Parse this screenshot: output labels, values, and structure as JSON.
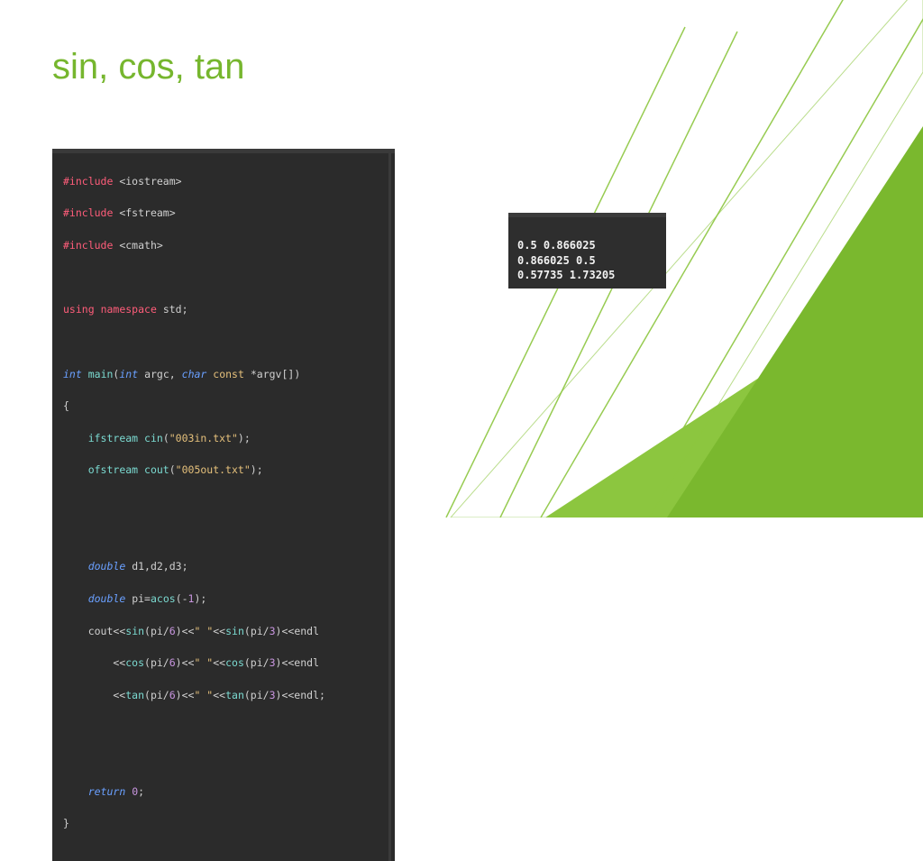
{
  "title": "sin, cos, tan",
  "code": {
    "l1a": "#include",
    "l1b": "<iostream>",
    "l2a": "#include",
    "l2b": "<fstream>",
    "l3a": "#include",
    "l3b": "<cmath>",
    "l5a": "using",
    "l5b": "namespace",
    "l5c": "std",
    "l7a": "int",
    "l7b": "main",
    "l7c": "int",
    "l7d": "argc",
    "l7e": "char",
    "l7f": "const",
    "l7g": "argv",
    "l8": "{",
    "l9a": "ifstream",
    "l9b": "cin",
    "l9c": "\"003in.txt\"",
    "l10a": "ofstream",
    "l10b": "cout",
    "l10c": "\"005out.txt\"",
    "l13a": "double",
    "l13b": "d1,d2,d3",
    "l14a": "double",
    "l14b": "pi",
    "l14c": "acos",
    "l14d": "1",
    "l15a": "cout",
    "l15b": "sin",
    "l15c": "6",
    "l15d": "\" \"",
    "l15e": "sin",
    "l15f": "3",
    "l15g": "endl",
    "l16a": "cos",
    "l16b": "6",
    "l16c": "\" \"",
    "l16d": "cos",
    "l16e": "3",
    "l16f": "endl",
    "l17a": "tan",
    "l17b": "6",
    "l17c": "\" \"",
    "l17d": "tan",
    "l17e": "3",
    "l17f": "endl",
    "l20a": "return",
    "l20b": "0",
    "l21": "}"
  },
  "output": {
    "line1": "0.5 0.866025",
    "line2": "0.866025 0.5",
    "line3": "0.57735 1.73205"
  }
}
